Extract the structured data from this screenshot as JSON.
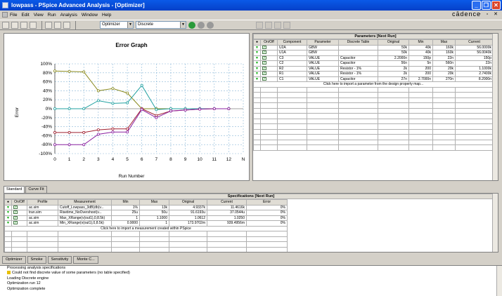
{
  "window": {
    "title": "lowpass - PSpice Advanced Analysis - [Optimizer]",
    "brand": "cādence"
  },
  "menu": [
    "File",
    "Edit",
    "View",
    "Run",
    "Analysis",
    "Window",
    "Help"
  ],
  "toolbar": {
    "engine": "Optimizer",
    "mode": "Discrete"
  },
  "graph": {
    "title": "Error Graph",
    "xlabel": "Run Number",
    "ylabel": "Error"
  },
  "chart_data": {
    "type": "line",
    "title": "Error Graph",
    "xlabel": "Run Number",
    "ylabel": "Error",
    "categories": [
      "0",
      "1",
      "2",
      "3",
      "4",
      "5",
      "6",
      "7",
      "8",
      "9",
      "10",
      "11",
      "12",
      "N"
    ],
    "ylim": [
      -100,
      100
    ],
    "yticks": [
      "100%",
      "80%",
      "60%",
      "40%",
      "20%",
      "0%",
      "-20%",
      "-40%",
      "-60%",
      "-80%",
      "-100%"
    ],
    "series": [
      {
        "color": "#8a8a20",
        "values": [
          84,
          83,
          82,
          40,
          45,
          35,
          0,
          0,
          0,
          0,
          0,
          0,
          0
        ]
      },
      {
        "color": "#20a0a0",
        "values": [
          0,
          0,
          0,
          18,
          12,
          13,
          52,
          -2,
          0,
          0,
          0,
          0,
          0
        ]
      },
      {
        "color": "#a02030",
        "values": [
          -53,
          -53,
          -53,
          -47,
          -45,
          -45,
          0,
          -15,
          -5,
          -3,
          -1,
          0,
          0
        ]
      },
      {
        "color": "#8a20a0",
        "values": [
          -80,
          -80,
          -80,
          -57,
          -52,
          -52,
          -2,
          -20,
          -5,
          -3,
          -1,
          0,
          0
        ]
      }
    ],
    "grid": true
  },
  "params": {
    "caption": "Parameters [Next Run]",
    "headers": [
      "●",
      "On/Off",
      "Component",
      "Parameter",
      "Discrete Table",
      "Original",
      "Min",
      "Max",
      "Current"
    ],
    "rows": [
      [
        "U2A",
        "GBW",
        "",
        "50k",
        "40k",
        "160k",
        "56.0000k"
      ],
      [
        "U1A",
        "GBW",
        "",
        "50k",
        "40k",
        "160k",
        "56.0040k"
      ],
      [
        "C3",
        "VALUE",
        "Capacitor",
        "2.2000n",
        "150p",
        "22n",
        "150p"
      ],
      [
        "C2",
        "VALUE",
        "Capacitor",
        "56n",
        "5n",
        "560n",
        "22n"
      ],
      [
        "R2",
        "VALUE",
        "Resistor - 1%",
        "2k",
        "200",
        "20k",
        "1.1000k"
      ],
      [
        "R1",
        "VALUE",
        "Resistor - 1%",
        "2k",
        "200",
        "20k",
        "2.7400k"
      ],
      [
        "C1",
        "VALUE",
        "Capacitor",
        "27n",
        "2.7000n",
        "270n",
        "8.2000n"
      ]
    ],
    "hint": "Click here to import a parameter from the design property map..."
  },
  "tabs": [
    "Standard",
    "Curve Fit"
  ],
  "specs": {
    "caption": "Specifications [Next Run]",
    "headers": [
      "●",
      "On/Off",
      "Profile",
      "Measurement",
      "Min",
      "Max",
      "Original",
      "Current",
      "Error"
    ],
    "rows": [
      [
        "ac.sim",
        "Cutoff_Lowpass_3dB(db(v...",
        "1%",
        "13k",
        "4.9337k",
        "11.4616k",
        "0%"
      ],
      [
        "tran.sim",
        "Risetime_NoOvershoot(v...",
        "25u",
        "50u",
        "91.6193u",
        "37.0544u",
        "0%"
      ],
      [
        "ac.sim",
        "Max_XRange(v(out1),0,8.5k)",
        "1",
        "1.1000",
        "1.0612",
        "1.0250",
        "0%"
      ],
      [
        "ac.sim",
        "Min_XRange(v(out1),0,8.5k)",
        "0.9000",
        "1",
        "173.9702m",
        "939.4956m",
        "0%"
      ]
    ],
    "hint": "Click here to import a measurement created within PSpice"
  },
  "bottom_tabs": [
    "Optimizer",
    "Smoke",
    "Sensitivity",
    "Monte C..."
  ],
  "output": [
    "Processing analysis specifications",
    "Could not find discrete value of some parameters (no table specified)",
    "Loading Discrete engine",
    "Optimization run 12",
    "Optimization complete"
  ]
}
